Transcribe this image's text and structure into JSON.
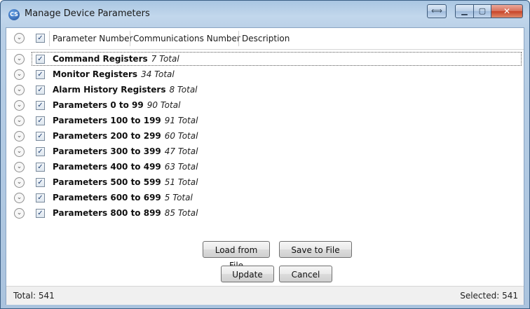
{
  "window": {
    "title": "Manage Device Parameters",
    "icon_name": "app-logo-icon",
    "icon_glyph": "CS",
    "resize_glyph": "⟺",
    "minimize_glyph": "▁",
    "maximize_glyph": "▢",
    "close_glyph": "✕"
  },
  "header": {
    "expander_glyph": "⌄",
    "check_glyph": "✓",
    "columns": [
      "Parameter Number",
      "Communications Number",
      "Description"
    ]
  },
  "rows": [
    {
      "name": "Command Registers",
      "count": "7 Total",
      "checked": true,
      "selected": true
    },
    {
      "name": "Monitor Registers",
      "count": "34 Total",
      "checked": true
    },
    {
      "name": "Alarm History Registers",
      "count": "8 Total",
      "checked": true
    },
    {
      "name": "Parameters 0 to 99",
      "count": "90 Total",
      "checked": true
    },
    {
      "name": "Parameters 100 to 199",
      "count": "91 Total",
      "checked": true
    },
    {
      "name": "Parameters 200 to 299",
      "count": "60 Total",
      "checked": true
    },
    {
      "name": "Parameters 300 to 399",
      "count": "47 Total",
      "checked": true
    },
    {
      "name": "Parameters 400 to 499",
      "count": "63 Total",
      "checked": true
    },
    {
      "name": "Parameters 500 to 599",
      "count": "51 Total",
      "checked": true
    },
    {
      "name": "Parameters 600 to 699",
      "count": "5 Total",
      "checked": true
    },
    {
      "name": "Parameters 800 to 899",
      "count": "85 Total",
      "checked": true
    }
  ],
  "buttons": {
    "load": "Load from File",
    "save": "Save to File",
    "update": "Update",
    "cancel": "Cancel"
  },
  "status": {
    "total": "Total: 541",
    "selected": "Selected: 541"
  },
  "colors": {
    "titlebar": "#b8cfe6",
    "close_button": "#c74328",
    "checkbox_check": "#1f3f72"
  }
}
